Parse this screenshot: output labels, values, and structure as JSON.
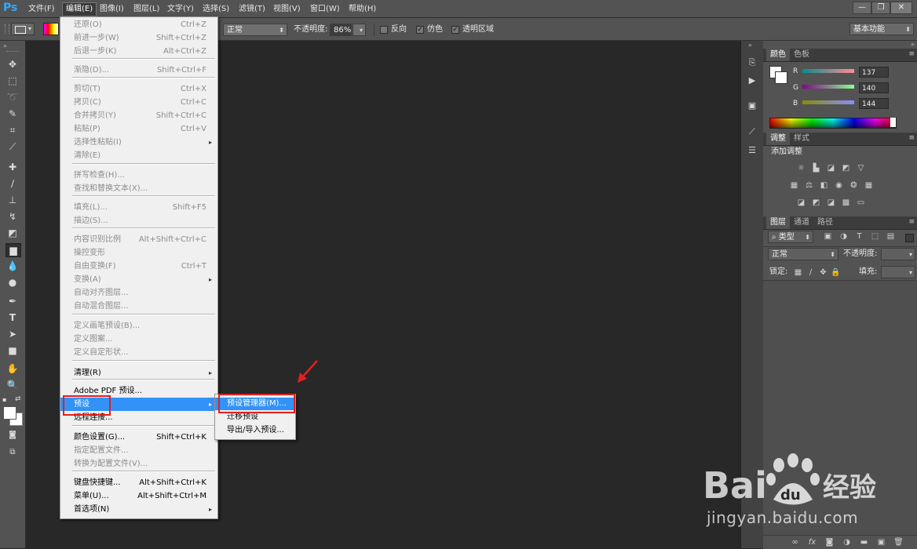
{
  "app": {
    "logo": "Ps"
  },
  "menubar": {
    "items": [
      "文件(F)",
      "编辑(E)",
      "图像(I)",
      "图层(L)",
      "文字(Y)",
      "选择(S)",
      "滤镜(T)",
      "视图(V)",
      "窗口(W)",
      "帮助(H)"
    ],
    "active_index": 1,
    "window_buttons": [
      "—",
      "❐",
      "✕"
    ]
  },
  "optionsbar": {
    "mode": "正常",
    "opacity_label": "不透明度:",
    "opacity_value": "86%",
    "reverse_label": "反向",
    "dither_label": "仿色",
    "transparency_label": "透明区域",
    "workspace": "基本功能"
  },
  "edit_menu": {
    "items": [
      {
        "label": "还原(O)",
        "shortcut": "Ctrl+Z",
        "disabled": true
      },
      {
        "label": "前进一步(W)",
        "shortcut": "Shift+Ctrl+Z",
        "disabled": true
      },
      {
        "label": "后退一步(K)",
        "shortcut": "Alt+Ctrl+Z",
        "disabled": true
      },
      {
        "label": "渐隐(D)...",
        "shortcut": "Shift+Ctrl+F",
        "disabled": true
      },
      {
        "label": "剪切(T)",
        "shortcut": "Ctrl+X",
        "disabled": true
      },
      {
        "label": "拷贝(C)",
        "shortcut": "Ctrl+C",
        "disabled": true
      },
      {
        "label": "合并拷贝(Y)",
        "shortcut": "Shift+Ctrl+C",
        "disabled": true
      },
      {
        "label": "粘贴(P)",
        "shortcut": "Ctrl+V",
        "disabled": true
      },
      {
        "label": "选择性粘贴(I)",
        "shortcut": "",
        "disabled": true
      },
      {
        "label": "清除(E)",
        "shortcut": "",
        "disabled": true
      },
      {
        "label": "拼写检查(H)...",
        "shortcut": "",
        "disabled": true
      },
      {
        "label": "查找和替换文本(X)...",
        "shortcut": "",
        "disabled": true
      },
      {
        "label": "填充(L)...",
        "shortcut": "Shift+F5",
        "disabled": true
      },
      {
        "label": "描边(S)...",
        "shortcut": "",
        "disabled": true
      },
      {
        "label": "内容识别比例",
        "shortcut": "Alt+Shift+Ctrl+C",
        "disabled": true
      },
      {
        "label": "操控变形",
        "shortcut": "",
        "disabled": true
      },
      {
        "label": "自由变换(F)",
        "shortcut": "Ctrl+T",
        "disabled": true
      },
      {
        "label": "变换(A)",
        "shortcut": "",
        "disabled": true
      },
      {
        "label": "自动对齐图层...",
        "shortcut": "",
        "disabled": true
      },
      {
        "label": "自动混合图层...",
        "shortcut": "",
        "disabled": true
      },
      {
        "label": "定义画笔预设(B)...",
        "shortcut": "",
        "disabled": true
      },
      {
        "label": "定义图案...",
        "shortcut": "",
        "disabled": true
      },
      {
        "label": "定义自定形状...",
        "shortcut": "",
        "disabled": true
      },
      {
        "label": "清理(R)",
        "shortcut": "",
        "disabled": false
      },
      {
        "label": "Adobe PDF 预设...",
        "shortcut": "",
        "disabled": false
      },
      {
        "label": "预设",
        "shortcut": "",
        "disabled": false
      },
      {
        "label": "远程连接...",
        "shortcut": "",
        "disabled": false
      },
      {
        "label": "颜色设置(G)...",
        "shortcut": "Shift+Ctrl+K",
        "disabled": false
      },
      {
        "label": "指定配置文件...",
        "shortcut": "",
        "disabled": true
      },
      {
        "label": "转换为配置文件(V)...",
        "shortcut": "",
        "disabled": true
      },
      {
        "label": "键盘快捷键...",
        "shortcut": "Alt+Shift+Ctrl+K",
        "disabled": false
      },
      {
        "label": "菜单(U)...",
        "shortcut": "Alt+Shift+Ctrl+M",
        "disabled": false
      },
      {
        "label": "首选项(N)",
        "shortcut": "",
        "disabled": false
      }
    ]
  },
  "presets_submenu": {
    "items": [
      "预设管理器(M)...",
      "迁移预设",
      "导出/导入预设..."
    ]
  },
  "color_panel": {
    "tabs": [
      "颜色",
      "色板"
    ],
    "r_label": "R",
    "g_label": "G",
    "b_label": "B",
    "r": "137",
    "g": "140",
    "b": "144"
  },
  "adjust_panel": {
    "tabs": [
      "调整",
      "样式"
    ],
    "title": "添加调整"
  },
  "layers_panel": {
    "tabs": [
      "图层",
      "通道",
      "路径"
    ],
    "filter": "类型",
    "blend": "正常",
    "opacity_label": "不透明度:",
    "lock_label": "锁定:",
    "fill_label": "填充:"
  },
  "watermark": {
    "logo": "Bai du 经验",
    "url": "jingyan.baidu.com"
  },
  "colors": {
    "highlight": "#3292f7",
    "annotation": "#e61e1e",
    "ps_blue": "#31a8ff"
  }
}
